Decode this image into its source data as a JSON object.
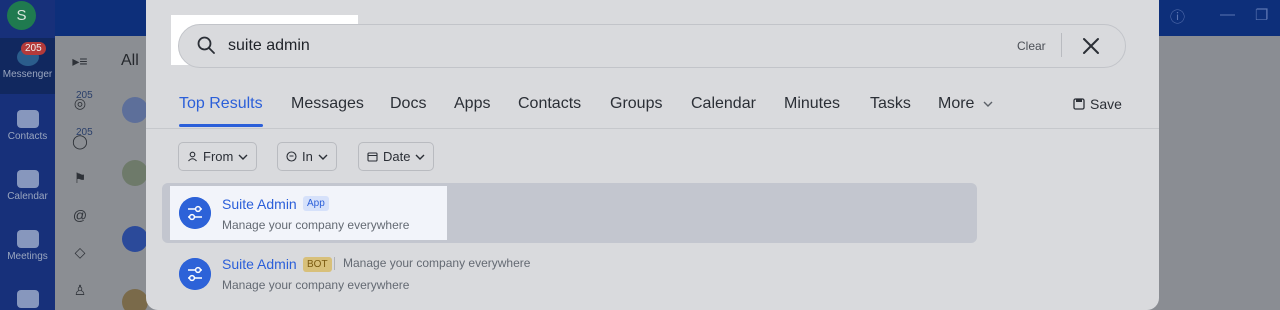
{
  "app": {
    "avatar_letter": "S",
    "rail": [
      {
        "label": "Messenger",
        "badge": "205"
      },
      {
        "label": "Contacts"
      },
      {
        "label": "Calendar"
      },
      {
        "label": "Meetings"
      }
    ],
    "side_badges": [
      "205",
      "205"
    ],
    "list_heading": "All"
  },
  "search": {
    "value": "suite admin",
    "clear_label": "Clear"
  },
  "tabs": [
    {
      "label": "Top Results",
      "active": true
    },
    {
      "label": "Messages"
    },
    {
      "label": "Docs"
    },
    {
      "label": "Apps"
    },
    {
      "label": "Contacts"
    },
    {
      "label": "Groups"
    },
    {
      "label": "Calendar"
    },
    {
      "label": "Minutes"
    },
    {
      "label": "Tasks"
    },
    {
      "label": "More"
    }
  ],
  "save_label": "Save",
  "filters": [
    {
      "label": "From",
      "icon": "person-icon"
    },
    {
      "label": "In",
      "icon": "chat-icon"
    },
    {
      "label": "Date",
      "icon": "calendar-icon"
    }
  ],
  "results": [
    {
      "title": "Suite Admin",
      "tag": "App",
      "description": "Manage your company everywhere"
    },
    {
      "title": "Suite Admin",
      "tag": "BOT",
      "inline_description": "Manage your company everywhere",
      "description": "Manage your company everywhere"
    }
  ],
  "colors": {
    "accent": "#2b5fd9",
    "app_icon": "#2d62d8",
    "badge": "#c53d3d"
  }
}
